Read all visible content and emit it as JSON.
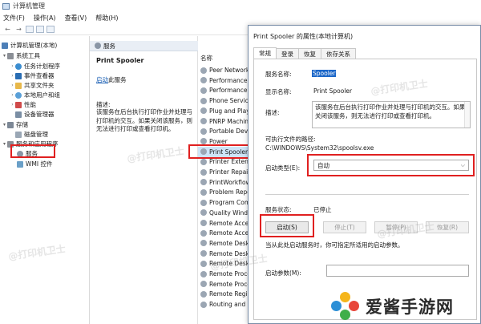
{
  "main_window": {
    "title": "计算机管理",
    "menu": [
      "文件(F)",
      "操作(A)",
      "查看(V)",
      "帮助(H)"
    ]
  },
  "tree": {
    "root": "计算机管理(本地)",
    "system_tools": "系统工具",
    "task_scheduler": "任务计划程序",
    "event_viewer": "事件查看器",
    "shared_folders": "共享文件夹",
    "local_users": "本地用户和组",
    "performance": "性能",
    "device_manager": "设备管理器",
    "storage": "存储",
    "disk_management": "磁盘管理",
    "services_apps": "服务和应用程序",
    "services": "服务",
    "wmi": "WMI 控件"
  },
  "desc_pane": {
    "header": "服务",
    "service_title": "Print Spooler",
    "start_link": "启动",
    "start_suffix": "此服务",
    "desc_label": "描述:",
    "desc_text": "该服务在后台执行打印作业并处理与打印机的交互。如果关闭该服务，则无法进行打印或查看打印机。"
  },
  "services_list": {
    "column": "名称",
    "items": [
      "Peer Network",
      "Performance C",
      "Performance L",
      "Phone Service",
      "Plug and Play",
      "PNRP Machine",
      "Portable Devi",
      "Power",
      "Print Spooler",
      "Printer Extensi",
      "Printer Repair",
      "PrintWorkflow",
      "Problem Repor",
      "Program Com",
      "Quality Windo",
      "Remote Access",
      "Remote Access",
      "Remote Deskt",
      "Remote Deskt",
      "Remote Deskt",
      "Remote Proce",
      "Remote Proce",
      "Remote Regis",
      "Routing and R"
    ],
    "selected": "Print Spooler"
  },
  "dialog": {
    "title": "Print Spooler 的属性(本地计算机)",
    "tabs": [
      "常规",
      "登录",
      "恢复",
      "依存关系"
    ],
    "service_name_label": "服务名称:",
    "service_name_value": "Spooler",
    "display_name_label": "显示名称:",
    "display_name_value": "Print Spooler",
    "description_label": "描述:",
    "description_value": "该服务在后台执行打印作业并处理与打印机的交互。如果关闭该服务，则无法进行打印或查看打印机。",
    "path_label": "可执行文件的路径:",
    "path_value": "C:\\WINDOWS\\System32\\spoolsv.exe",
    "startup_type_label": "启动类型(E):",
    "startup_type_value": "自动",
    "status_label": "服务状态:",
    "status_value": "已停止",
    "btn_start": "启动(S)",
    "btn_stop": "停止(T)",
    "btn_pause": "暂停(P)",
    "btn_resume": "恢复(R)",
    "hint": "当从此处启动服务时，你可指定所适用的启动参数。",
    "params_label": "启动参数(M):"
  },
  "watermark": "@打印机卫士",
  "logo": {
    "text": "爱酱手游网"
  },
  "colors": {
    "highlight": "#e02020",
    "accent": "#1a66c8",
    "selection": "#cde4f7"
  }
}
